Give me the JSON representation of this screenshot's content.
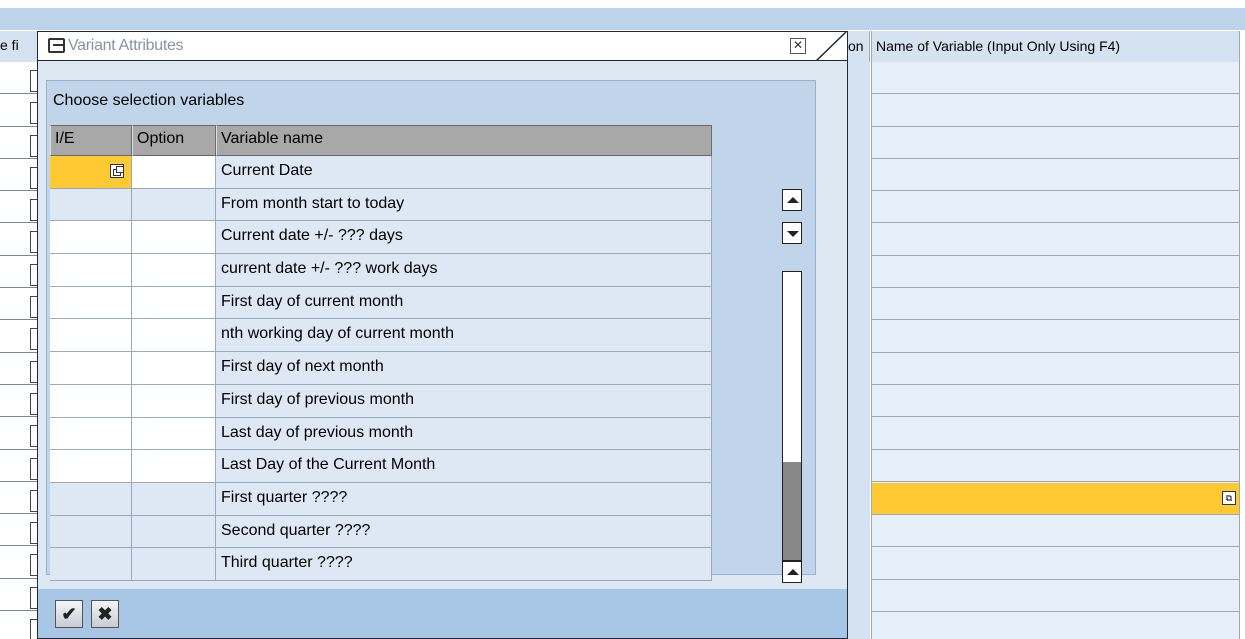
{
  "background": {
    "left_header_fragment": "e fi",
    "mid_header_fragment": "on",
    "right_header": "Name of Variable (Input Only Using F4)",
    "row_count": 18,
    "selected_row_index": 13
  },
  "dialog": {
    "title": "Variant Attributes",
    "section_title": "Choose selection variables",
    "columns": [
      "I/E",
      "Option",
      "Variable name"
    ],
    "rows": [
      {
        "ie": "",
        "option": "",
        "name": "Current Date",
        "active": true
      },
      {
        "ie": "",
        "option": "",
        "name": "From month start to today",
        "shaded": true
      },
      {
        "ie": "",
        "option": "",
        "name": "Current date +/- ??? days"
      },
      {
        "ie": "",
        "option": "",
        "name": "current date +/- ??? work days"
      },
      {
        "ie": "",
        "option": "",
        "name": "First day of current month"
      },
      {
        "ie": "",
        "option": "",
        "name": "nth working day of current month"
      },
      {
        "ie": "",
        "option": "",
        "name": "First day of next month"
      },
      {
        "ie": "",
        "option": "",
        "name": "First day of previous month"
      },
      {
        "ie": "",
        "option": "",
        "name": "Last day of previous month"
      },
      {
        "ie": "",
        "option": "",
        "name": "Last Day of the Current Month"
      },
      {
        "ie": "",
        "option": "",
        "name": "First quarter ????",
        "shaded": true
      },
      {
        "ie": "",
        "option": "",
        "name": "Second quarter ????",
        "shaded": true
      },
      {
        "ie": "",
        "option": "",
        "name": "Third quarter ????",
        "shaded": true
      }
    ],
    "footer_buttons": [
      {
        "icon": "checkmark-icon",
        "glyph": "✔"
      },
      {
        "icon": "cancel-x-icon",
        "glyph": "✖"
      }
    ]
  },
  "colors": {
    "active_yellow": "#ffc934",
    "header_gray": "#a8a8a8",
    "panel_blue": "#c0d5ea",
    "footer_blue": "#a7c5e5"
  }
}
